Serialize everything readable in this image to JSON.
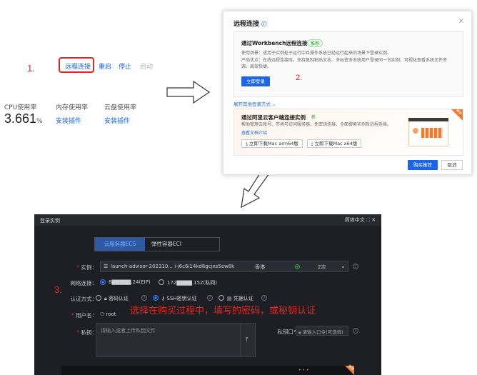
{
  "top_left": {
    "step": "1.",
    "actions": [
      "远程连接",
      "重启",
      "停止",
      "启动"
    ],
    "metrics": [
      {
        "label": "CPU使用率",
        "value": "3.661",
        "unit": "%"
      },
      {
        "label": "内存使用率",
        "link": "安装插件"
      },
      {
        "label": "云盘使用率",
        "link": "安装插件"
      }
    ]
  },
  "dialog": {
    "title": "远程连接",
    "card1": {
      "title": "通过Workbench远程连接",
      "tag": "推荐",
      "line1": "使用场景：适用于实例处于运行中且操作系统已经运行起来的场景下登录实例。",
      "line2": "产品优点：在线远程连接时，支持复制粘贴文本、多标签多系统用户登录同一台实例、可视化查看系统文件资",
      "line3": "源、高效快捷。",
      "button": "立即登录",
      "step": "2."
    },
    "expand_link": "展开其他登录方式",
    "card2": {
      "title": "通过阿里云客户端连接实例",
      "tag": "新",
      "line1": "帮助管理云账号、市场与访问服务器，免密钥连接、全面搜索实例及远程连接。",
      "link": "查看文档介绍",
      "btn_arm": "立即下载Mac arm64版",
      "btn_x64": "立即下载Mac x64版",
      "badge": "推荐"
    },
    "footer": {
      "primary": "购买推荐",
      "secondary": "取消"
    }
  },
  "login": {
    "title": "登录实例",
    "right_tools": "简体中文",
    "tabs": [
      "云服务器ECS",
      "弹性容器ECI"
    ],
    "step": "3.",
    "instance_label": "实例：",
    "instance_value": "launch-advisor-202310...  i-j6c6i14kd8gcjxs5ew8k",
    "region": "香港",
    "count": "2次",
    "network_label": "网络连接：",
    "network_eip": "8▇▇▇▇▇.24(EIP)",
    "network_private": "172▇▇▇▇.152(私网)",
    "auth_label": "认证方式：",
    "auth_options": [
      "密码认证",
      "SSH密钥认证",
      "凭据认证"
    ],
    "user_label": "用户名：",
    "user_value": "root",
    "key_label": "私钥：",
    "key_placeholder": "请输入或者上传私钥文件",
    "passphrase_label": "私钥口令：",
    "passphrase_placeholder": "请输入口令(可选填)",
    "overlay_note": "选择在购买过程中，填写的密码，或秘钥认证",
    "bottom_badge": "推荐"
  },
  "colors": {
    "accent": "#1a66e6",
    "highlight": "#e8251b",
    "dark_bg": "#1e1f24"
  }
}
